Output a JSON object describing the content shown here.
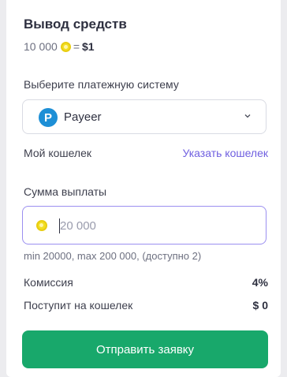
{
  "header": {
    "title": "Вывод средств",
    "rate_amount": "10 000",
    "rate_equals": "=",
    "rate_value": "$1"
  },
  "payment": {
    "label": "Выберите платежную систему",
    "selected": "Payeer",
    "logo_letter": "P"
  },
  "wallet": {
    "label": "Мой кошелек",
    "link": "Указать кошелек"
  },
  "amount": {
    "label": "Сумма выплаты",
    "placeholder": "20 000",
    "hint": "min 20000, max 200 000, (доступно 2)"
  },
  "summary": {
    "commission_label": "Комиссия",
    "commission_value": "4%",
    "receive_label": "Поступит на кошелек",
    "receive_value": "$ 0"
  },
  "submit_label": "Отправить заявку",
  "colors": {
    "accent": "#18a86b",
    "link": "#6f5fe0",
    "input_focus": "#9b8ff0",
    "payeer": "#1d8fd6",
    "coin": "#f2de22"
  },
  "icons": [
    "coin-icon",
    "payeer-logo",
    "chevron-down-icon"
  ]
}
